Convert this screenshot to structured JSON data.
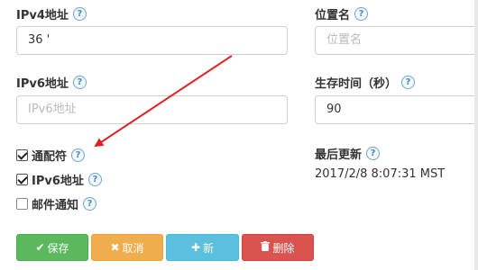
{
  "fields": {
    "ipv4_label": "IPv4地址",
    "ipv4_value": "36 '",
    "location_label": "位置名",
    "location_placeholder": "位置名",
    "ipv6_label": "IPv6地址",
    "ipv6_placeholder": "IPv6地址",
    "ttl_label": "生存时间（秒）",
    "ttl_value": "90"
  },
  "checkboxes": [
    {
      "label": "通配符",
      "checked": true
    },
    {
      "label": "IPv6地址",
      "checked": true
    },
    {
      "label": "邮件通知",
      "checked": false
    }
  ],
  "last_update": {
    "label": "最后更新",
    "value": "2017/2/8 8:07:31 MST"
  },
  "help_glyph": "?",
  "buttons": {
    "save": {
      "label": "保存",
      "icon": "check-icon",
      "glyph": "✔",
      "color": "#5cb85c"
    },
    "cancel": {
      "label": "取消",
      "icon": "close-icon",
      "glyph": "✖",
      "color": "#f0ad4e"
    },
    "new": {
      "label": "新",
      "icon": "plus-icon",
      "glyph": "✚",
      "color": "#5bc0de"
    },
    "delete": {
      "label": "删除",
      "icon": "trash-icon",
      "glyph": "🗑",
      "color": "#d9534f"
    }
  },
  "annotation": {
    "color": "#e02020",
    "icon": "red-arrow-annotation"
  }
}
